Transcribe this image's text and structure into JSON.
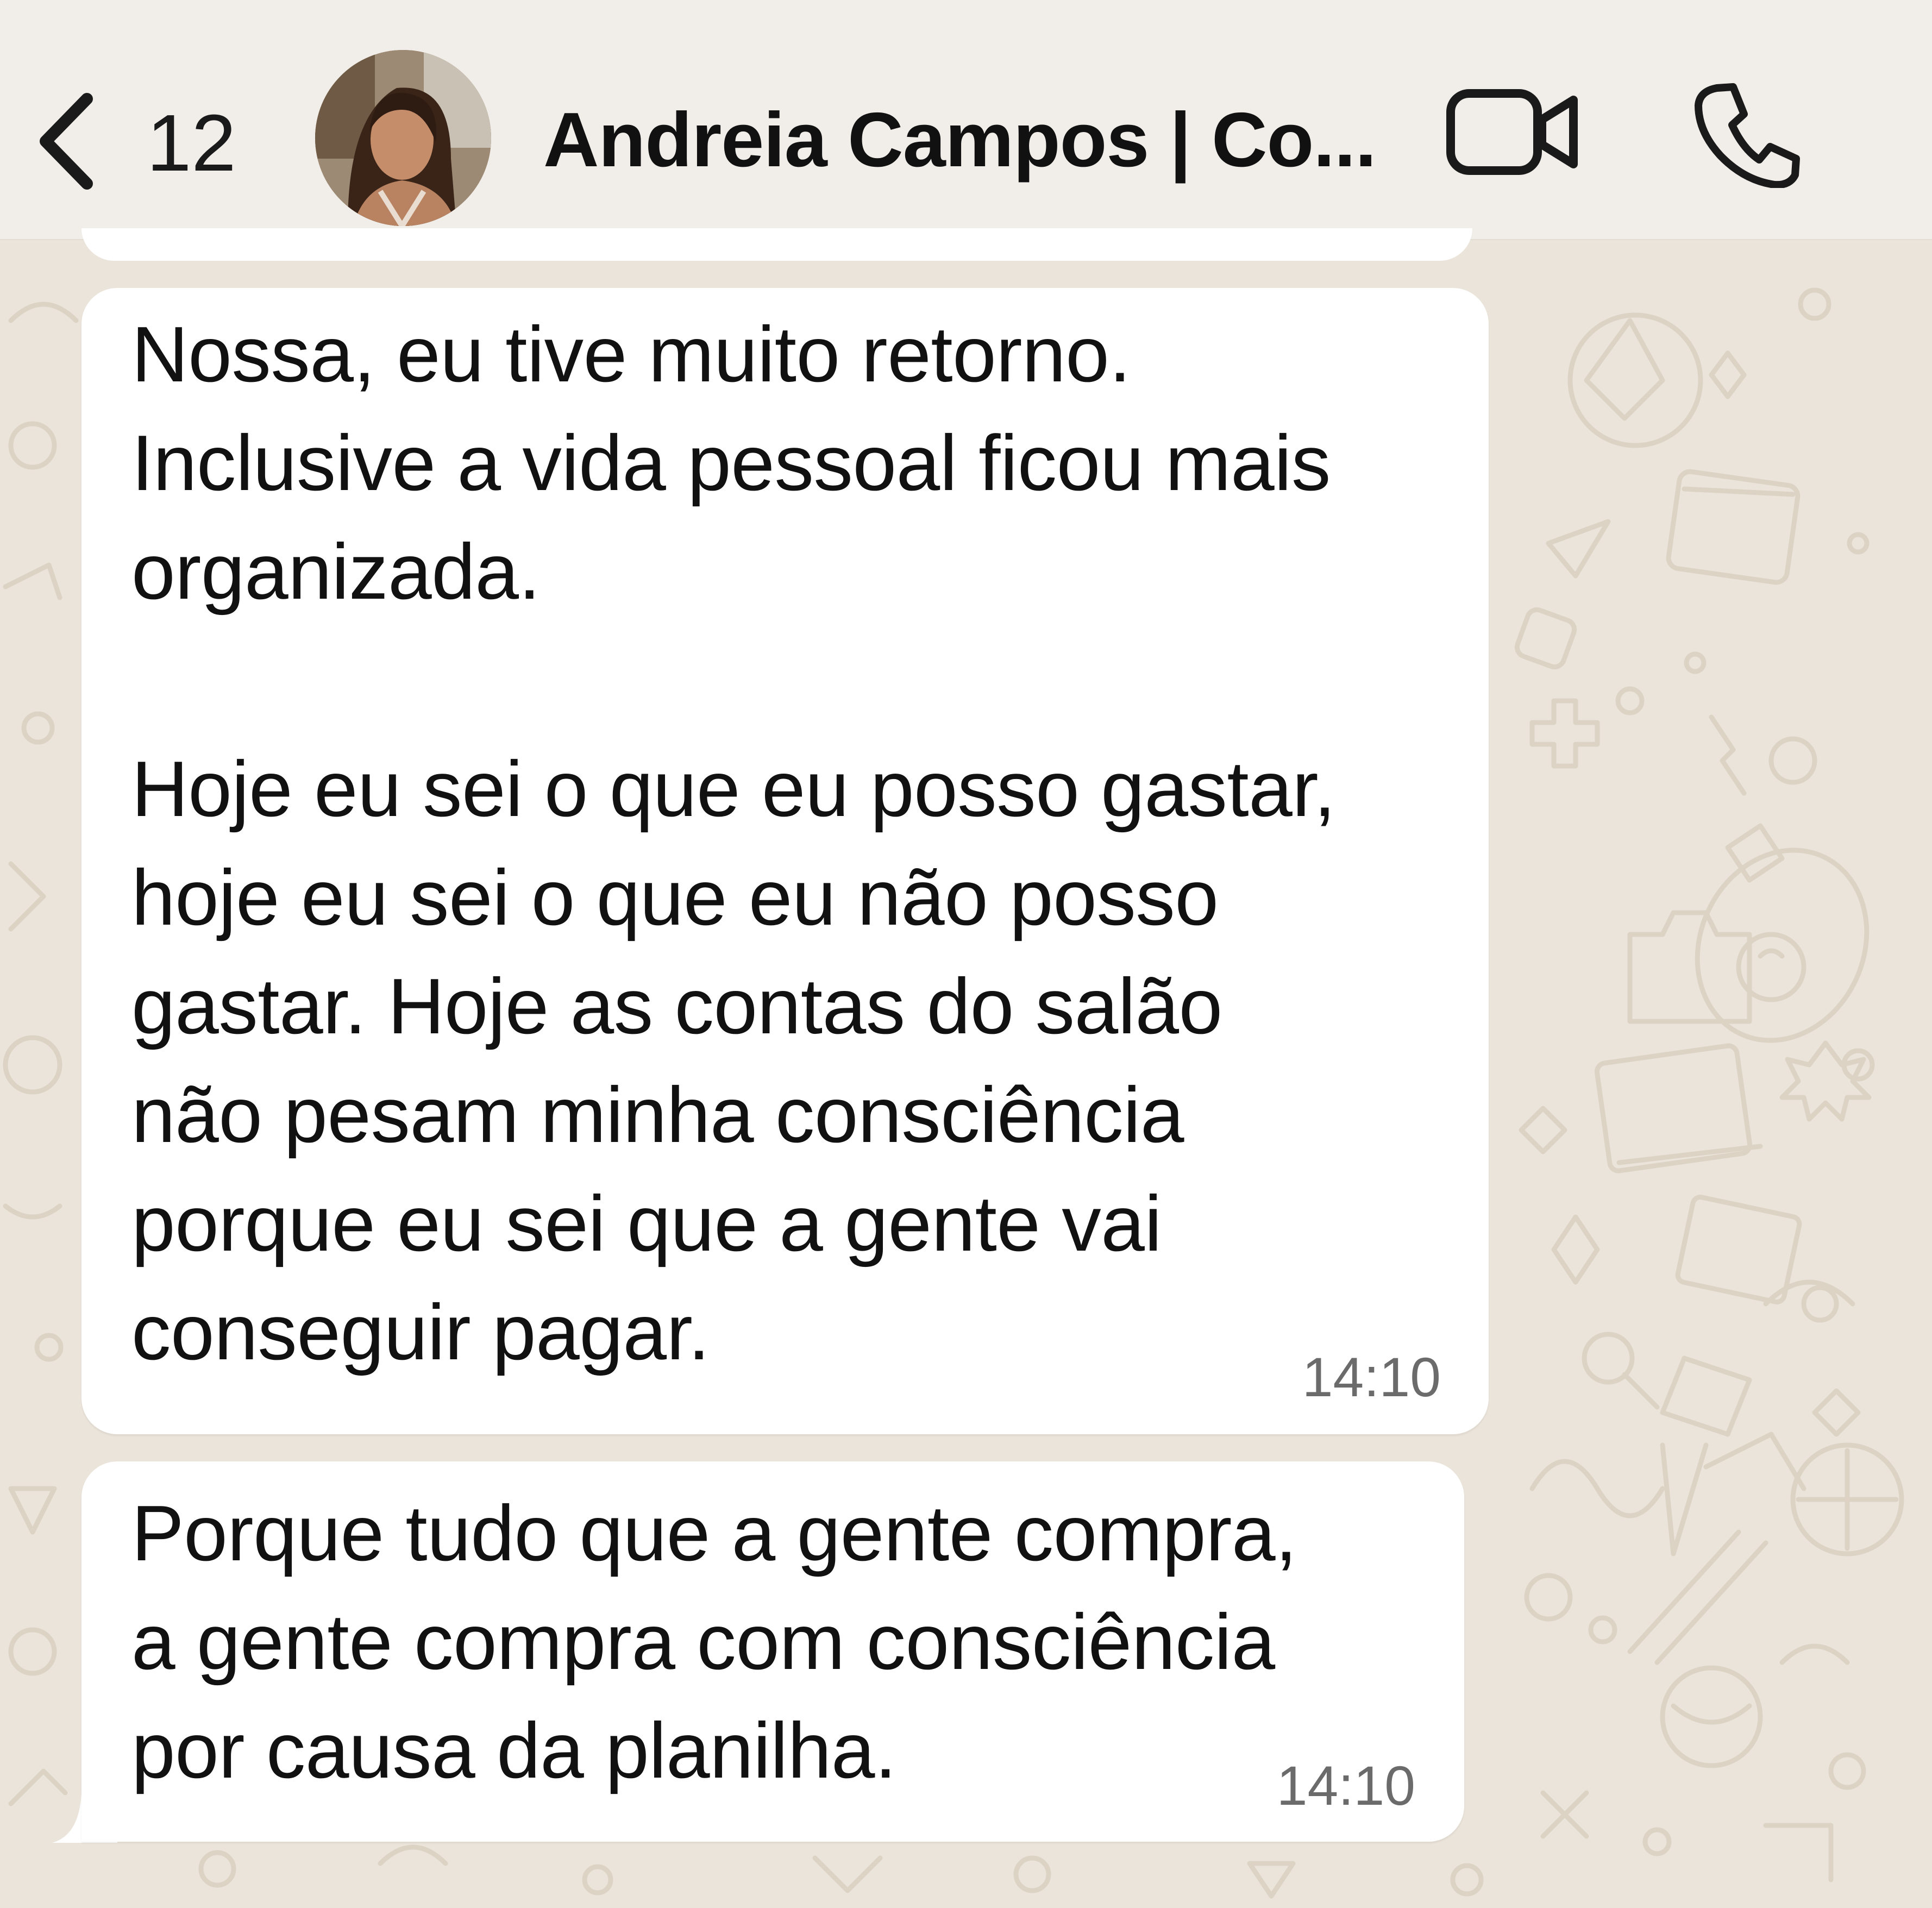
{
  "header": {
    "back_count": "12",
    "contact_name": "Andreia Campos | Co...",
    "back_icon": "chevron-left-icon",
    "video_icon": "video-camera-icon",
    "call_icon": "phone-icon"
  },
  "messages": [
    {
      "direction": "incoming",
      "text": "Nossa, eu tive muito retorno.\nInclusive a vida pessoal ficou mais\norganizada.\n\nHoje eu sei o que eu posso gastar,\nhoje eu sei o que eu não posso\ngastar. Hoje as contas do salão\nnão pesam minha consciência\nporque eu sei que a gente vai\nconseguir pagar.",
      "time": "14:10"
    },
    {
      "direction": "incoming",
      "text": "Porque tudo que a gente compra,\na gente compra com consciência\npor causa da planilha.",
      "time": "14:10"
    }
  ],
  "colors": {
    "header_bg": "#f1eee9",
    "chat_bg": "#ebe4da",
    "bubble_bg": "#ffffff",
    "text": "#111111",
    "time_text": "#6b6b6b"
  }
}
